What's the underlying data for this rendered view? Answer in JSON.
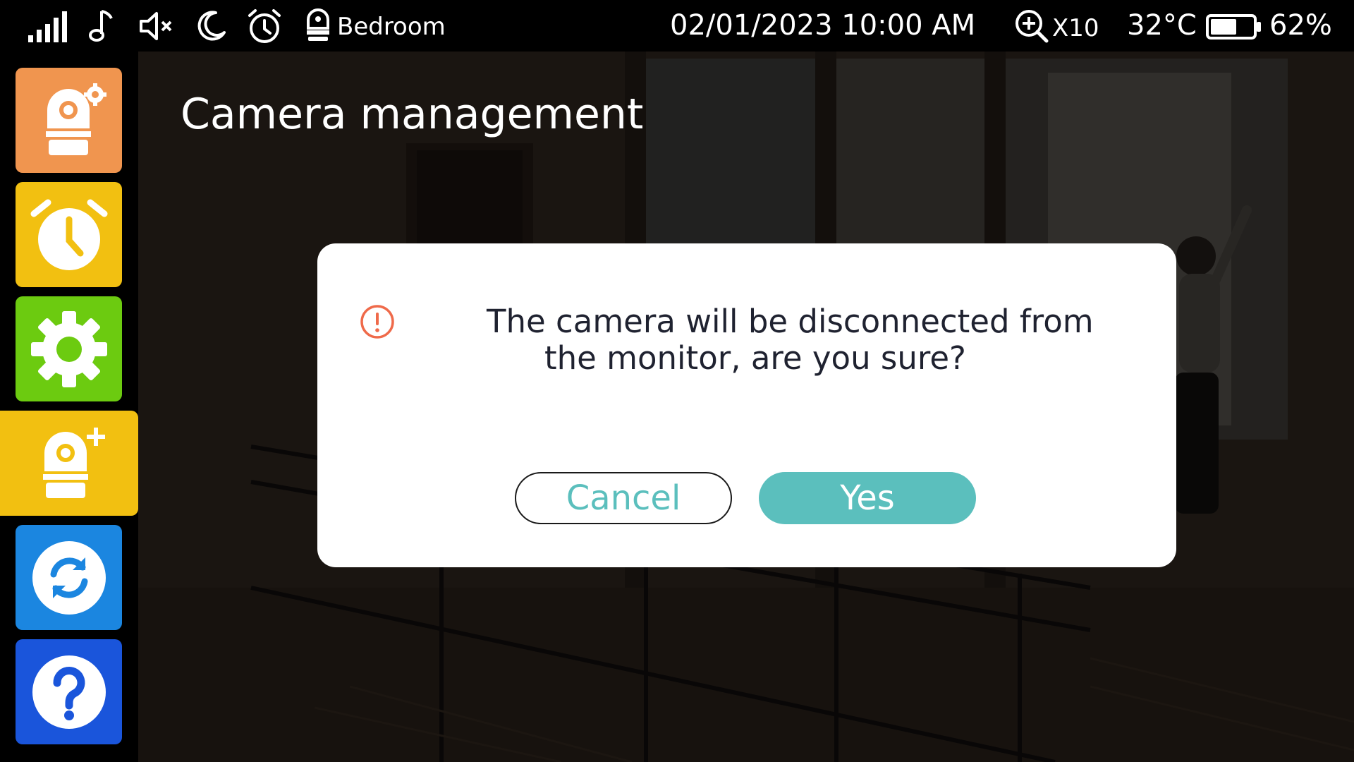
{
  "status_bar": {
    "location": "Bedroom",
    "datetime": "02/01/2023 10:00  AM",
    "zoom": "X10",
    "temperature": "32°C",
    "battery": {
      "percent_label": "62%",
      "level": 62
    },
    "icons": [
      "signal-icon",
      "music-note-icon",
      "speaker-mute-icon",
      "moon-icon",
      "alarm-clock-icon",
      "camera-icon",
      "zoom-in-icon",
      "battery-icon"
    ]
  },
  "sidebar": {
    "items": [
      {
        "name": "camera-settings",
        "icon": "camera-gear-icon",
        "color": "#f0954f"
      },
      {
        "name": "alarm",
        "icon": "alarm-clock-icon",
        "color": "#f2c011"
      },
      {
        "name": "settings",
        "icon": "gear-icon",
        "color": "#6ccb10"
      },
      {
        "name": "add-camera",
        "icon": "camera-add-icon",
        "color": "#f2c011",
        "active": true
      },
      {
        "name": "sync",
        "icon": "sync-icon",
        "color": "#1b86e0"
      },
      {
        "name": "help",
        "icon": "question-icon",
        "color": "#1a55db"
      }
    ]
  },
  "page": {
    "title": "Camera management"
  },
  "dialog": {
    "message_line1": "The camera will be disconnected from",
    "message_line2": "the monitor, are you sure?",
    "cancel_label": "Cancel",
    "yes_label": "Yes",
    "accent_color": "#5bbfbd",
    "warning_color": "#ef6a4a"
  }
}
